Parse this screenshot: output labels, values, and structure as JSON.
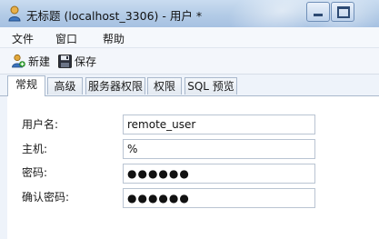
{
  "window": {
    "title": "无标题 (localhost_3306) - 用户 *"
  },
  "menu": {
    "items": [
      {
        "label": "文件"
      },
      {
        "label": "窗口"
      },
      {
        "label": "帮助"
      }
    ]
  },
  "toolbar": {
    "new_label": "新建",
    "save_label": "保存"
  },
  "tabs": [
    {
      "label": "常规",
      "active": true
    },
    {
      "label": "高级"
    },
    {
      "label": "服务器权限"
    },
    {
      "label": "权限"
    },
    {
      "label": "SQL 预览"
    }
  ],
  "form": {
    "username": {
      "label": "用户名:",
      "value": "remote_user"
    },
    "host": {
      "label": "主机:",
      "value": "%"
    },
    "password": {
      "label": "密码:",
      "value": "●●●●●●"
    },
    "confirm_password": {
      "label": "确认密码:",
      "value": "●●●●●●"
    }
  },
  "icons": {
    "app": "database-user-icon",
    "new": "new-user-icon",
    "save": "save-disk-icon"
  }
}
